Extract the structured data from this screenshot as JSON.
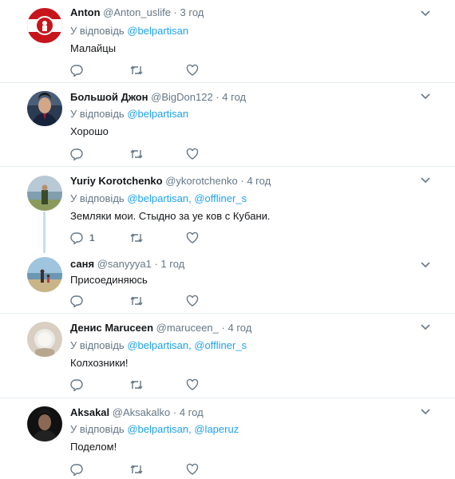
{
  "tweets": [
    {
      "name": "Anton",
      "handle": "@Anton_uslife",
      "time": "3 год",
      "reply_prefix": "У відповідь",
      "reply_to": [
        "@belpartisan"
      ],
      "text": "Малайцы",
      "reply_count": "",
      "avatar": "anton-avatar"
    },
    {
      "name": "Большой Джон",
      "handle": "@BigDon122",
      "time": "4 год",
      "reply_prefix": "У відповідь",
      "reply_to": [
        "@belpartisan"
      ],
      "text": "Хорошо",
      "reply_count": "",
      "avatar": "bigdon-avatar"
    },
    {
      "name": "Yuriy Korotchenko",
      "handle": "@ykorotchenko",
      "time": "4 год",
      "reply_prefix": "У відповідь",
      "reply_to": [
        "@belpartisan",
        "@offliner_s"
      ],
      "text": "Земляки мои. Стыдно за уе  ков с Кубани.",
      "reply_count": "1",
      "avatar": "yuriy-avatar"
    },
    {
      "name": "саня",
      "handle": "@sanyyya1",
      "time": "1 год",
      "reply_prefix": "",
      "reply_to": [],
      "text": "Присоединяюсь",
      "reply_count": "",
      "avatar": "sanya-avatar"
    },
    {
      "name": "Денис Maruceen",
      "handle": "@maruceen_",
      "time": "4 год",
      "reply_prefix": "У відповідь",
      "reply_to": [
        "@belpartisan",
        "@offliner_s"
      ],
      "text": "Колхозники!",
      "reply_count": "",
      "avatar": "denis-avatar"
    },
    {
      "name": "Aksakal",
      "handle": "@Aksakalko",
      "time": "4 год",
      "reply_prefix": "У відповідь",
      "reply_to": [
        "@belpartisan",
        "@laperuz"
      ],
      "text": "Поделом!",
      "reply_count": "",
      "avatar": "aksakal-avatar"
    }
  ],
  "separator": "·",
  "colors": {
    "link": "#1da1f2",
    "muted": "#657786",
    "text": "#14171a",
    "thread": "#c5dff2"
  }
}
